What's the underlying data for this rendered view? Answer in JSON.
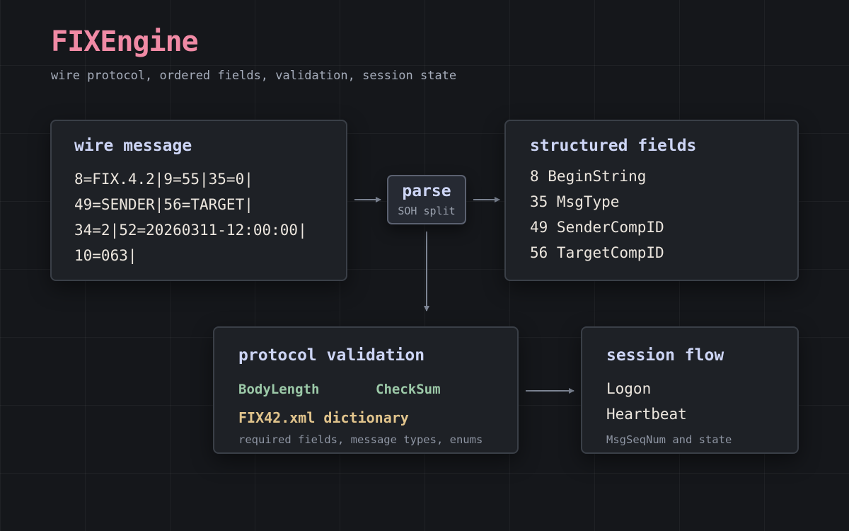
{
  "header": {
    "title": "FIXEngine",
    "subtitle": "wire protocol, ordered fields, validation, session state"
  },
  "wire_message": {
    "title": "wire message",
    "lines": [
      "8=FIX.4.2|9=55|35=0|",
      "49=SENDER|56=TARGET|",
      "34=2|52=20260311-12:00:00|",
      "10=063|"
    ]
  },
  "parse": {
    "title": "parse",
    "subtitle": "SOH split"
  },
  "structured_fields": {
    "title": "structured fields",
    "items": [
      "8 BeginString",
      "35 MsgType",
      "49 SenderCompID",
      "56 TargetCompID"
    ]
  },
  "protocol_validation": {
    "title": "protocol validation",
    "checks": [
      "BodyLength",
      "CheckSum"
    ],
    "dictionary": "FIX42.xml dictionary",
    "note": "required fields, message types, enums"
  },
  "session_flow": {
    "title": "session flow",
    "items": [
      "Logon",
      "Heartbeat"
    ],
    "note": "MsgSeqNum and state"
  },
  "colors": {
    "background": "#15171b",
    "card": "#1e2126",
    "title_accent": "#f08aa5",
    "card_heading": "#cdd5f5",
    "check_green": "#9cc9a8",
    "dictionary_gold": "#e1c48c",
    "arrow": "#7d8594"
  }
}
